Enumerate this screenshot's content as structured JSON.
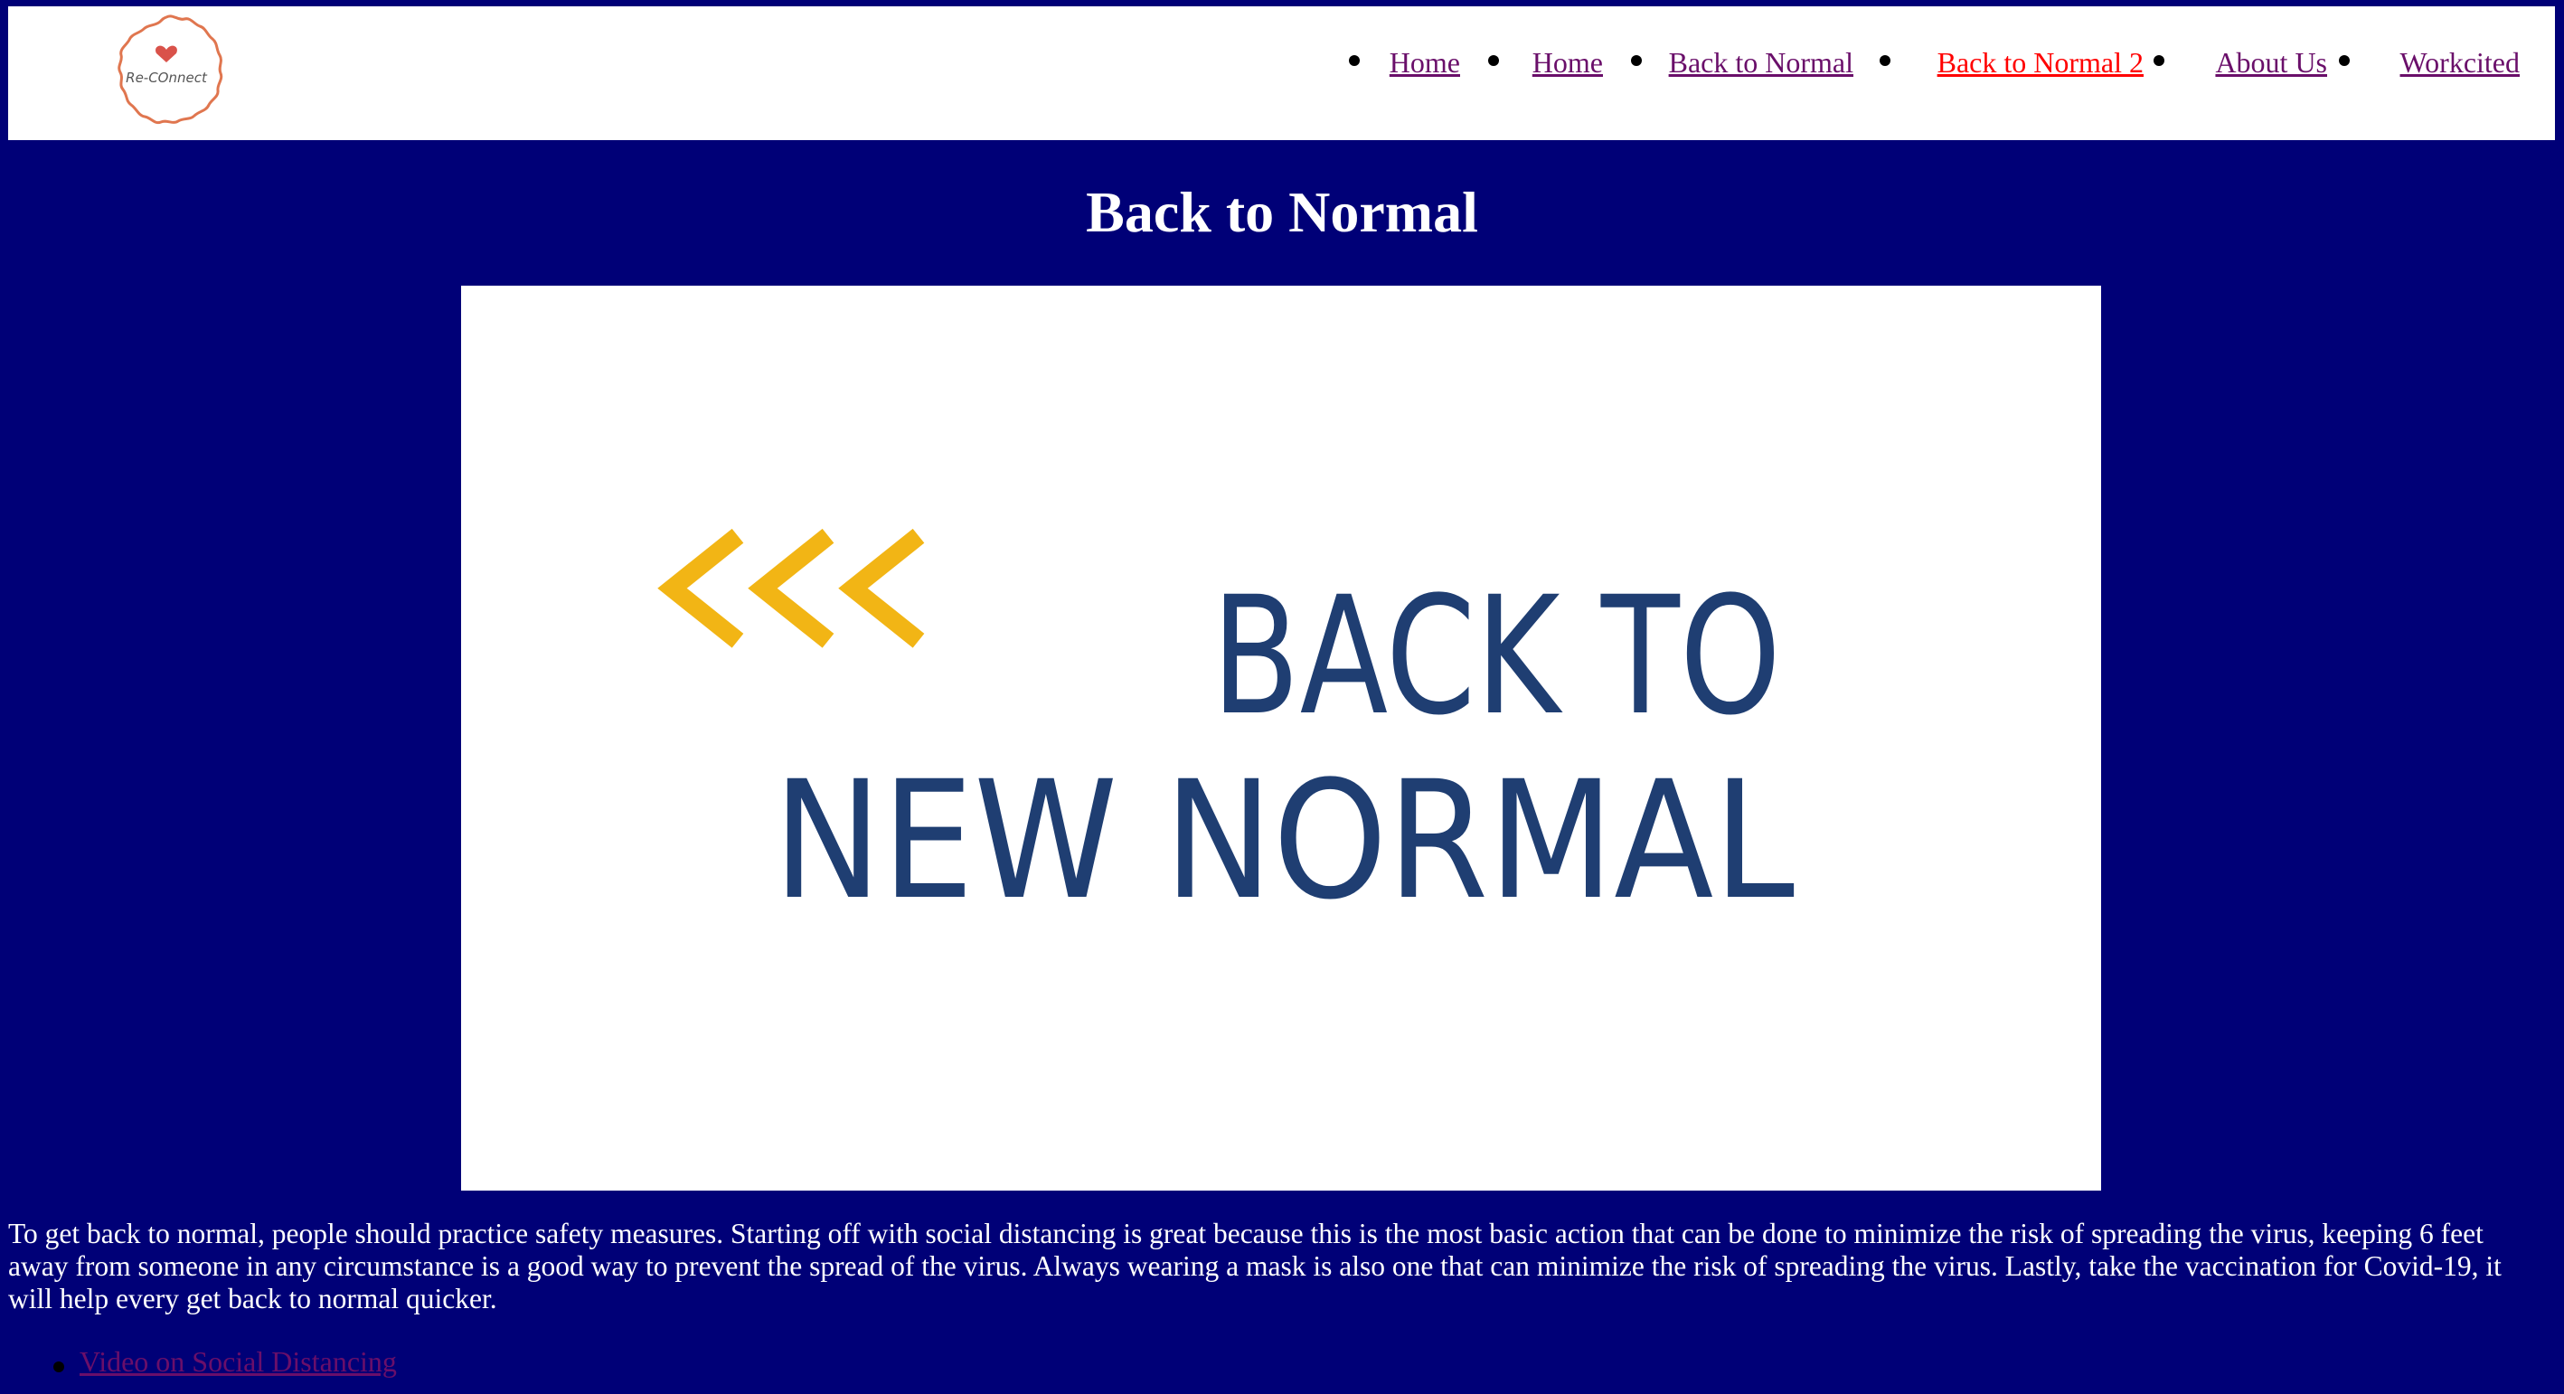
{
  "logo": {
    "text": "Re-COnnect",
    "icon": "heart-icon"
  },
  "nav": {
    "items": [
      {
        "label": "Home",
        "active": false
      },
      {
        "label": "Home",
        "active": false
      },
      {
        "label": "Back to Normal",
        "active": false
      },
      {
        "label": "Back to Normal 2",
        "active": true
      },
      {
        "label": "About Us",
        "active": false
      },
      {
        "label": "Workcited",
        "active": false
      }
    ]
  },
  "main": {
    "title": "Back to Normal",
    "hero": {
      "line1": "BACK TO",
      "line2": "NEW NORMAL",
      "arrows": "<<<"
    },
    "body": "To get back to normal, people should practice safety measures. Starting off with social distancing is great because this is the most basic action that can be done to minimize the risk of spreading the virus, keeping 6 feet away from someone in any circumstance is a good way to prevent the spread of the virus. Always wearing a mask is also one that can minimize the risk of spreading the virus. Lastly, take the vaccination for Covid-19, it will help every get back to normal quicker.",
    "links": [
      {
        "label": "Video on Social Distancing"
      }
    ]
  },
  "colors": {
    "page_background": "#000077",
    "nav_background": "#ffffff",
    "link_visited": "#6a0f6a",
    "link_active": "#ff0000",
    "text": "#ffffff",
    "hero_arrow": "#f2b515",
    "hero_text": "#1f3e72",
    "logo_ring": "#e0764f"
  }
}
